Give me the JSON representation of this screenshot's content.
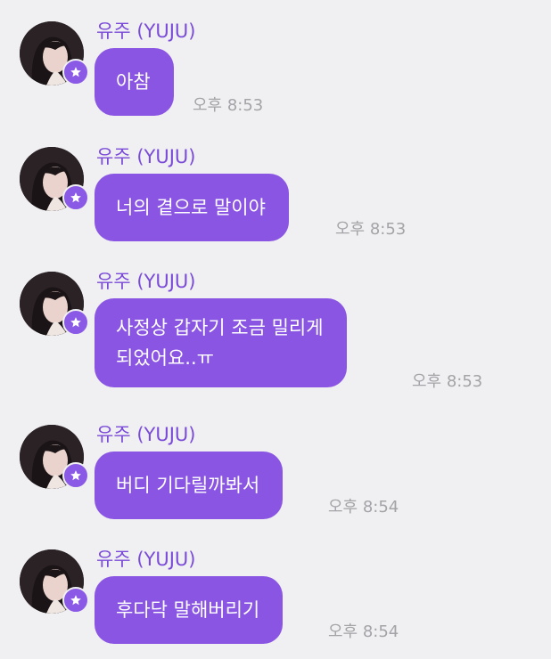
{
  "messages": [
    {
      "sender": "유주 (YUJU)",
      "text": "아참",
      "time": "오후 8:53"
    },
    {
      "sender": "유주 (YUJU)",
      "text": "너의 곁으로 말이야",
      "time": "오후 8:53"
    },
    {
      "sender": "유주 (YUJU)",
      "text": "사정상 갑자기 조금 밀리게\n되었어요..ㅠ",
      "time": "오후 8:53"
    },
    {
      "sender": "유주 (YUJU)",
      "text": "버디 기다릴까봐서",
      "time": "오후 8:54"
    },
    {
      "sender": "유주 (YUJU)",
      "text": "후다닥 말해버리기",
      "time": "오후 8:54"
    }
  ],
  "colors": {
    "background": "#f0f0f2",
    "bubble": "#8a55e2",
    "sender_name": "#7a4ad8",
    "timestamp": "#a3a3a8",
    "badge": "#8a5ae6"
  },
  "icons": {
    "avatar": "profile-photo",
    "badge": "star-icon"
  }
}
